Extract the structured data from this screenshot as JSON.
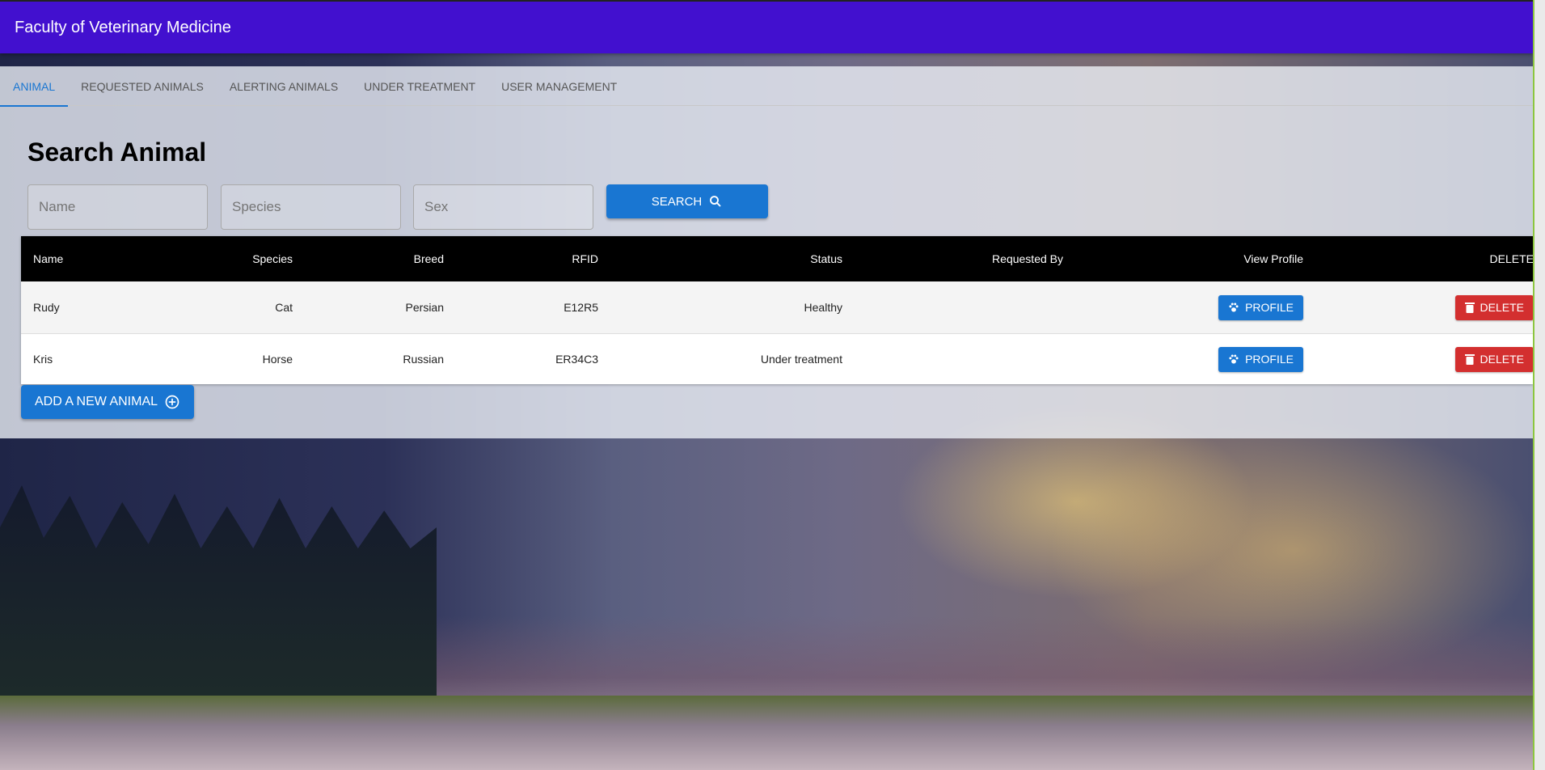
{
  "header": {
    "title": "Faculty of Veterinary Medicine",
    "color": "#4210cf"
  },
  "tabs": [
    {
      "label": "ANIMAL",
      "active": true
    },
    {
      "label": "REQUESTED ANIMALS"
    },
    {
      "label": "ALERTING ANIMALS"
    },
    {
      "label": "UNDER TREATMENT"
    },
    {
      "label": "USER MANAGEMENT"
    }
  ],
  "search": {
    "title": "Search Animal",
    "name_placeholder": "Name",
    "species_placeholder": "Species",
    "sex_placeholder": "Sex",
    "button_label": "SEARCH"
  },
  "table": {
    "columns": [
      "Name",
      "Species",
      "Breed",
      "RFID",
      "Status",
      "Requested By",
      "View Profile",
      "DELETE"
    ],
    "rows": [
      {
        "name": "Rudy",
        "species": "Cat",
        "breed": "Persian",
        "rfid": "E12R5",
        "status": "Healthy",
        "requested_by": "",
        "profile_label": "PROFILE",
        "delete_label": "DELETE"
      },
      {
        "name": "Kris",
        "species": "Horse",
        "breed": "Russian",
        "rfid": "ER34C3",
        "status": "Under treatment",
        "requested_by": "",
        "profile_label": "PROFILE",
        "delete_label": "DELETE"
      }
    ]
  },
  "add_button_label": "ADD A NEW ANIMAL",
  "colors": {
    "primary": "#1976d2",
    "danger": "#d32f2f"
  }
}
